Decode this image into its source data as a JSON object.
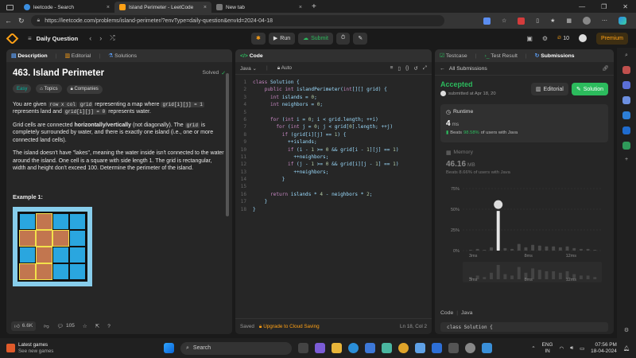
{
  "browser": {
    "tabs": [
      {
        "title": "leetcode - Search",
        "active": false
      },
      {
        "title": "Island Perimeter - LeetCode",
        "active": true
      },
      {
        "title": "New tab",
        "active": false
      }
    ],
    "url": "https://leetcode.com/problems/island-perimeter/?envType=daily-question&envId=2024-04-18"
  },
  "header": {
    "title": "Daily Question",
    "run": "Run",
    "submit": "Submit",
    "streak": "10",
    "premium": "Premium"
  },
  "left_panel": {
    "tabs": [
      "Description",
      "Editorial",
      "Solutions"
    ],
    "problem_title": "463. Island Perimeter",
    "status": "Solved",
    "difficulty": "Easy",
    "tags": [
      "Topics",
      "Companies"
    ],
    "p1": {
      "a": "You are given ",
      "c1": "row x col",
      "b": " ",
      "c2": "grid",
      "c": " representing a map where ",
      "c3": "grid[i][j] = 1",
      "d": " represents land and ",
      "c4": "grid[i][j] = 0",
      "e": " represents water."
    },
    "p2": {
      "a": "Grid cells are connected ",
      "b": "horizontally/vertically",
      "c": " (not diagonally). The ",
      "c1": "grid",
      "d": " is completely surrounded by water, and there is exactly one island (i.e., one or more connected land cells)."
    },
    "p3": "The island doesn't have \"lakes\", meaning the water inside isn't connected to the water around the island. One cell is a square with side length 1. The grid is rectangular, width and height don't exceed 100. Determine the perimeter of the island.",
    "example": "Example 1:",
    "likes": "6.6K",
    "comments": "105"
  },
  "code_panel": {
    "tab": "Code",
    "language": "Java",
    "mode": "Auto",
    "lines": [
      "class Solution {",
      "    public int islandPerimeter(int[][] grid) {",
      "      int islands = 0;",
      "      int neighbors = 0;",
      "",
      "      for (int i = 0; i < grid.length; ++i)",
      "        for (int j = 0; j < grid[0].length; ++j)",
      "          if (grid[i][j] == 1) {",
      "            ++islands;",
      "            if (i - 1 >= 0 && grid[i - 1][j] == 1)",
      "              ++neighbors;",
      "            if (j - 1 >= 0 && grid[i][j - 1] == 1)",
      "              ++neighbors;",
      "          }",
      "",
      "      return islands * 4 - neighbors * 2;",
      "    }",
      "}"
    ],
    "saved": "Saved",
    "upgrade": "Upgrade to Cloud Saving",
    "position": "Ln 18, Col 2"
  },
  "result_panel": {
    "tabs": [
      "Testcase",
      "Test Result",
      "Submissions"
    ],
    "back": "All Submissions",
    "status": "Accepted",
    "submitted": "submitted at Apr 18, 20",
    "editorial": "Editorial",
    "solution": "Solution",
    "runtime_label": "Runtime",
    "runtime_value": "4",
    "runtime_unit": "ms",
    "runtime_beats_a": "Beats ",
    "runtime_beats_pct": "98.58%",
    "runtime_beats_b": " of users with Java",
    "memory_label": "Memory",
    "memory_value": "46.16",
    "memory_unit": "MB",
    "memory_beats": "Beats 8.66% of users with Java",
    "y_ticks": [
      "75%",
      "50%",
      "25%",
      "0%"
    ],
    "x_ticks": [
      "3ms",
      "8ms",
      "12ms"
    ],
    "code_label": "Code",
    "code_lang": "Java",
    "code_preview": "class Solution {"
  },
  "chart_data": {
    "type": "bar",
    "ylim": [
      0,
      75
    ],
    "y_ticks": [
      "75%",
      "50%",
      "25%",
      "0%"
    ],
    "x_ticks": [
      "3ms",
      "8ms",
      "12ms"
    ],
    "values": [
      1,
      2,
      1,
      4,
      48,
      3,
      2,
      8,
      4,
      7,
      6,
      5,
      5,
      4,
      5,
      3,
      2,
      2,
      1
    ],
    "highlight_index": 4,
    "colors": {
      "bar": "#4a4a4a",
      "highlight": "#e6e6e6"
    }
  },
  "taskbar": {
    "news_title": "Latest games",
    "news_sub": "See new games",
    "search": "Search",
    "lang_top": "ENG",
    "lang_bottom": "IN",
    "time": "07:56 PM",
    "date": "18-04-2024"
  },
  "colors": {
    "accent": "#ffa116",
    "green": "#2cbb5d",
    "easy": "#00b8a3"
  }
}
